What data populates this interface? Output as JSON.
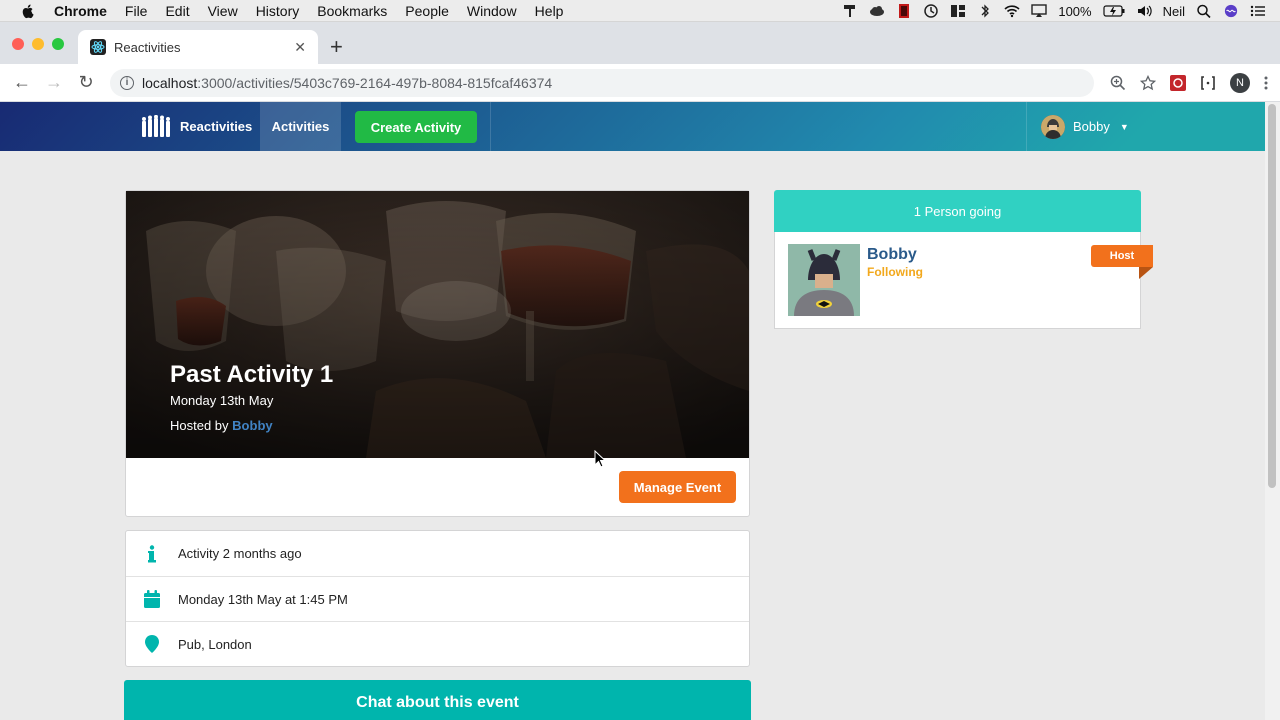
{
  "os_menu": {
    "app": "Chrome",
    "items": [
      "File",
      "Edit",
      "View",
      "History",
      "Bookmarks",
      "People",
      "Window",
      "Help"
    ],
    "battery": "100%",
    "user": "Neil"
  },
  "browser": {
    "tab_title": "Reactivities",
    "url_host": "localhost",
    "url_path": ":3000/activities/5403c769-2164-497b-8084-815fcaf46374",
    "profile_initial": "N"
  },
  "nav": {
    "brand": "Reactivities",
    "activities": "Activities",
    "create": "Create Activity",
    "user": "Bobby"
  },
  "activity": {
    "title": "Past Activity 1",
    "date": "Monday 13th May",
    "hosted_by_label": "Hosted by",
    "host": "Bobby",
    "manage_label": "Manage Event",
    "info_rows": [
      {
        "icon": "info-icon",
        "text": "Activity 2 months ago"
      },
      {
        "icon": "calendar-icon",
        "text": "Monday 13th May at 1:45 PM"
      },
      {
        "icon": "map-marker-icon",
        "text": "Pub, London"
      }
    ],
    "chat_label": "Chat about this event"
  },
  "sidebar": {
    "header": "1 Person going",
    "attendee": {
      "name": "Bobby",
      "status": "Following",
      "badge": "Host"
    }
  },
  "colors": {
    "teal": "#00b5ad",
    "orange": "#f2711c",
    "green": "#21ba45",
    "nav_start": "#182a73",
    "nav_end": "#20a7ac"
  }
}
